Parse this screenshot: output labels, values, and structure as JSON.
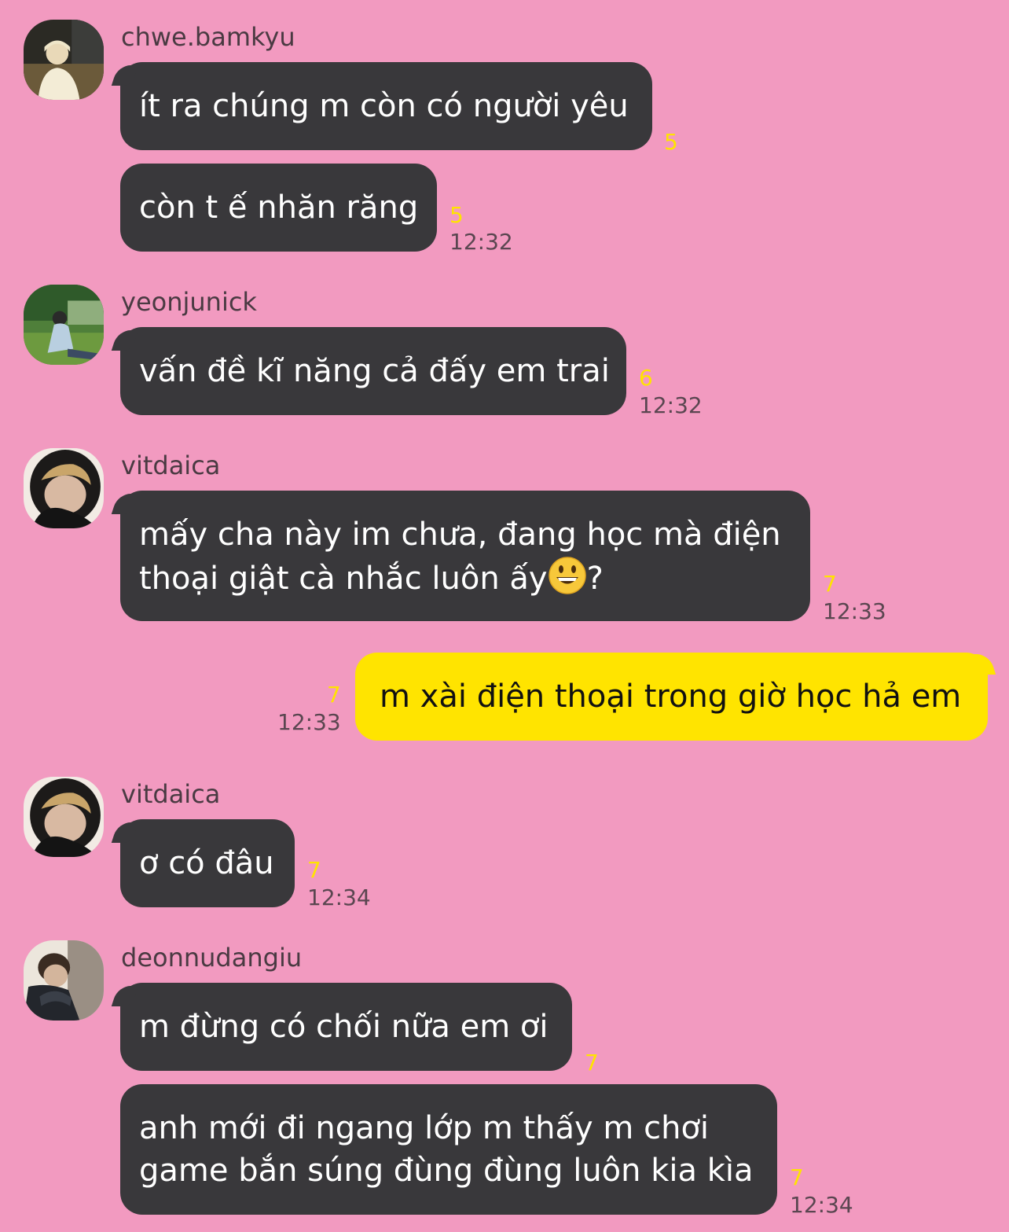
{
  "messages": [
    {
      "sender": "chwe.bamkyu",
      "text": "ít ra chúng m còn có người yêu",
      "unread": "5"
    },
    {
      "sender": "chwe.bamkyu",
      "text": "còn t ế nhăn răng",
      "unread": "5",
      "time": "12:32"
    },
    {
      "sender": "yeonjunick",
      "text": "vấn đề kĩ năng cả đấy em trai",
      "unread": "6",
      "time": "12:32"
    },
    {
      "sender": "vitdaica",
      "line1": "mấy cha này im chưa, đang học mà điện",
      "line2a": "thoại giật cà nhắc luôn ấy",
      "line2b": "?",
      "unread": "7",
      "time": "12:33",
      "emoji": "grinning-face-emoji"
    },
    {
      "sender": "me",
      "text": "m xài điện thoại trong giờ học hả em",
      "unread": "7",
      "time": "12:33"
    },
    {
      "sender": "vitdaica",
      "text": "ơ có đâu",
      "unread": "7",
      "time": "12:34"
    },
    {
      "sender": "deonnudangiu",
      "text": "m đừng có chối nữa em ơi",
      "unread": "7"
    },
    {
      "sender": "deonnudangiu",
      "line1": "anh mới đi ngang lớp m thấy m chơi",
      "line2": "game bắn súng đùng đùng luôn kia kìa",
      "unread": "7",
      "time": "12:34"
    }
  ],
  "colors": {
    "background": "#f29ac0",
    "bubble_other": "#39383b",
    "bubble_mine": "#ffe400",
    "unread_count": "#ffe400"
  }
}
